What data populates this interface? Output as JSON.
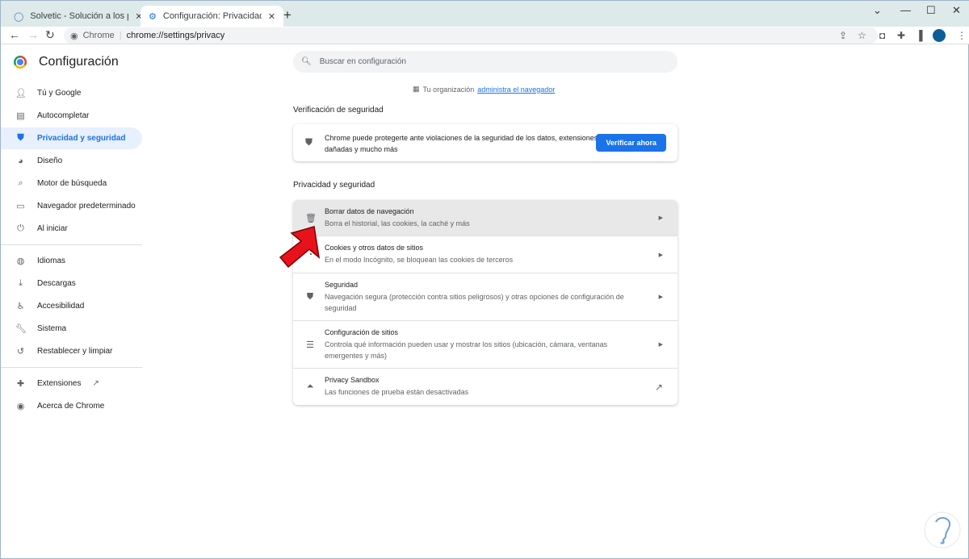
{
  "tabs": [
    {
      "title": "Solvetic - Solución a los problemas",
      "icon": "solvetic-icon"
    },
    {
      "title": "Configuración: Privacidad y seguridad",
      "icon": "gear-icon",
      "active": true
    }
  ],
  "omnibox": {
    "chip": "Chrome",
    "url": "chrome://settings/privacy"
  },
  "header": {
    "title": "Configuración"
  },
  "search": {
    "placeholder": "Buscar en configuración"
  },
  "sidebar": {
    "items": [
      {
        "label": "Tú y Google",
        "icon": "person-icon"
      },
      {
        "label": "Autocompletar",
        "icon": "clipboard-icon"
      },
      {
        "label": "Privacidad y seguridad",
        "icon": "shield-icon",
        "active": true
      },
      {
        "label": "Diseño",
        "icon": "palette-icon"
      },
      {
        "label": "Motor de búsqueda",
        "icon": "search-icon"
      },
      {
        "label": "Navegador predeterminado",
        "icon": "browser-icon"
      },
      {
        "label": "Al iniciar",
        "icon": "power-icon"
      },
      {
        "label": "Idiomas",
        "icon": "globe-icon"
      },
      {
        "label": "Descargas",
        "icon": "download-icon"
      },
      {
        "label": "Accesibilidad",
        "icon": "accessibility-icon"
      },
      {
        "label": "Sistema",
        "icon": "wrench-icon"
      },
      {
        "label": "Restablecer y limpiar",
        "icon": "reset-icon"
      },
      {
        "label": "Extensiones",
        "icon": "puzzle-icon"
      },
      {
        "label": "Acerca de Chrome",
        "icon": "chrome-icon"
      }
    ]
  },
  "org": {
    "text": "Tu organización",
    "link": "administra el navegador"
  },
  "safety": {
    "title": "Verificación de seguridad",
    "text": "Chrome puede protegerte ante violaciones de la seguridad de los datos, extensiones dañadas y mucho más",
    "button": "Verificar ahora"
  },
  "privacy": {
    "title": "Privacidad y seguridad",
    "rows": [
      {
        "title": "Borrar datos de navegación",
        "subtitle": "Borra el historial, las cookies, la caché y más",
        "icon": "trash-icon"
      },
      {
        "title": "Cookies y otros datos de sitios",
        "subtitle": "En el modo Incógnito, se bloquean las cookies de terceros",
        "icon": "cookie-icon"
      },
      {
        "title": "Seguridad",
        "subtitle": "Navegación segura (protección contra sitios peligrosos) y otras opciones de configuración de seguridad",
        "icon": "shield-icon"
      },
      {
        "title": "Configuración de sitios",
        "subtitle": "Controla qué información pueden usar y mostrar los sitios (ubicación, cámara, ventanas emergentes y más)",
        "icon": "sliders-icon"
      },
      {
        "title": "Privacy Sandbox",
        "subtitle": "Las funciones de prueba están desactivadas",
        "icon": "flask-icon"
      }
    ]
  },
  "colors": {
    "accent": "#1a73e8",
    "annotation_arrow": "#e8121b"
  }
}
